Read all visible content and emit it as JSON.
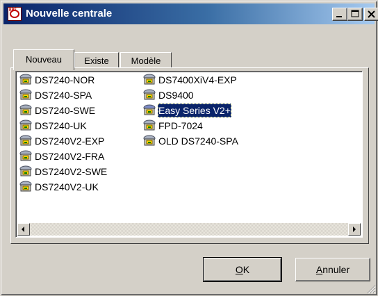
{
  "window": {
    "title": "Nouvelle centrale",
    "app_icon_text": "RPS",
    "min_glyph": "_",
    "max_glyph": "□",
    "close_glyph": "×"
  },
  "tabs": [
    {
      "label": "Nouveau",
      "active": true
    },
    {
      "label": "Existe",
      "active": false
    },
    {
      "label": "Modèle",
      "active": false
    }
  ],
  "list": {
    "items": [
      {
        "label": "DS7240-NOR",
        "selected": false
      },
      {
        "label": "DS7240-SPA",
        "selected": false
      },
      {
        "label": "DS7240-SWE",
        "selected": false
      },
      {
        "label": "DS7240-UK",
        "selected": false
      },
      {
        "label": "DS7240V2-EXP",
        "selected": false
      },
      {
        "label": "DS7240V2-FRA",
        "selected": false
      },
      {
        "label": "DS7240V2-SWE",
        "selected": false
      },
      {
        "label": "DS7240V2-UK",
        "selected": false
      },
      {
        "label": "DS7400XiV4-EXP",
        "selected": false
      },
      {
        "label": "DS9400",
        "selected": false
      },
      {
        "label": "Easy Series V2+",
        "selected": true
      },
      {
        "label": "FPD-7024",
        "selected": false
      },
      {
        "label": "OLD DS7240-SPA",
        "selected": false
      }
    ],
    "icon": "panel-device-icon"
  },
  "buttons": {
    "ok_prefix": "",
    "ok_mnemonic": "O",
    "ok_rest": "K",
    "cancel_mnemonic": "A",
    "cancel_rest": "nnuler"
  },
  "colors": {
    "title_start": "#0a246a",
    "title_end": "#a6caf0",
    "selection": "#0a246a",
    "face": "#d4d0c8"
  }
}
